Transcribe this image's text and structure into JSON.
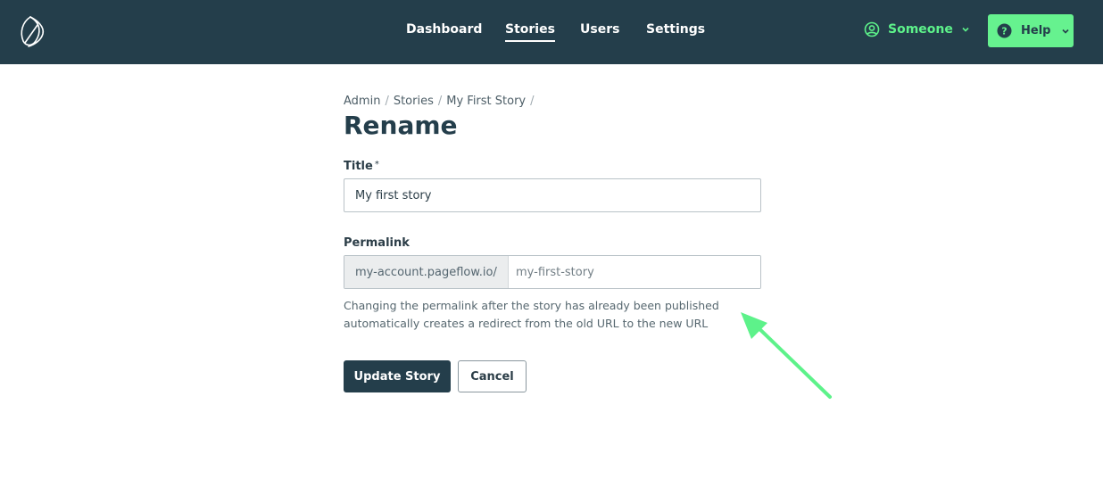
{
  "header": {
    "logo_icon": "pageflow-logo-icon",
    "nav": [
      {
        "label": "Dashboard"
      },
      {
        "label": "Stories"
      },
      {
        "label": "Users"
      },
      {
        "label": "Settings"
      }
    ],
    "active_nav": "Stories",
    "user": {
      "name": "Someone",
      "icon": "user-circle-icon"
    },
    "help": {
      "label": "Help",
      "icon": "question-circle-icon"
    }
  },
  "breadcrumb": [
    "Admin",
    "Stories",
    "My First Story"
  ],
  "page_title": "Rename",
  "form": {
    "title_label": "Title",
    "title_required_mark": "*",
    "title_value": "My first story",
    "permalink_label": "Permalink",
    "permalink_prefix": "my-account.pageflow.io/",
    "permalink_placeholder": "my-first-story",
    "permalink_hint": "Changing the permalink after the story has already been published automatically creates a redirect from the old URL to the new URL",
    "submit_label": "Update Story",
    "cancel_label": "Cancel"
  },
  "colors": {
    "header_bg": "#243e4b",
    "accent_green": "#66f28f",
    "primary_button": "#243e4b"
  }
}
